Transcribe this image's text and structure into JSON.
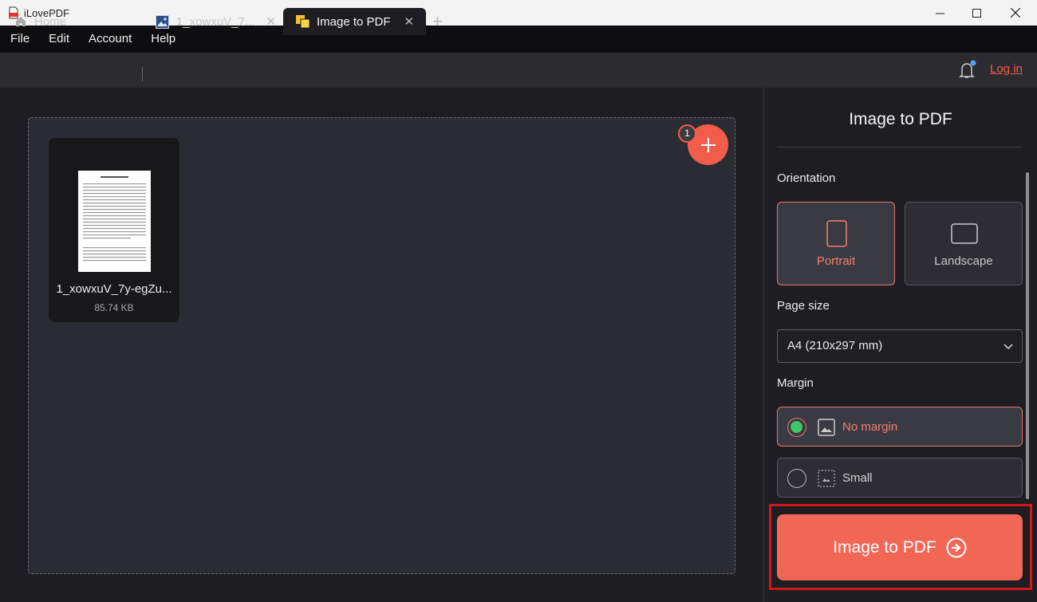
{
  "window": {
    "title": "iLovePDF"
  },
  "menu": {
    "items": [
      "File",
      "Edit",
      "Account",
      "Help"
    ]
  },
  "tabs": [
    {
      "label": "Home",
      "icon": "home-icon"
    },
    {
      "label": "1_xowxuV_7...",
      "icon": "image-icon"
    },
    {
      "label": "Image to PDF",
      "icon": "image-to-pdf-icon",
      "active": true
    }
  ],
  "header": {
    "login_label": "Log in"
  },
  "files": [
    {
      "name": "1_xowxuV_7y-egZu...",
      "size": "85.74 KB"
    }
  ],
  "add_button": {
    "badge": "1"
  },
  "panel": {
    "title": "Image to PDF",
    "orientation": {
      "label": "Orientation",
      "options": [
        {
          "label": "Portrait",
          "selected": true
        },
        {
          "label": "Landscape",
          "selected": false
        }
      ]
    },
    "page_size": {
      "label": "Page size",
      "value": "A4 (210x297 mm)"
    },
    "margin": {
      "label": "Margin",
      "options": [
        {
          "label": "No margin",
          "selected": true
        },
        {
          "label": "Small",
          "selected": false
        }
      ]
    },
    "action_label": "Image to PDF"
  },
  "colors": {
    "accent": "#f25c4b",
    "highlight_frame": "#d3161a",
    "radio_on": "#3ec76a"
  }
}
